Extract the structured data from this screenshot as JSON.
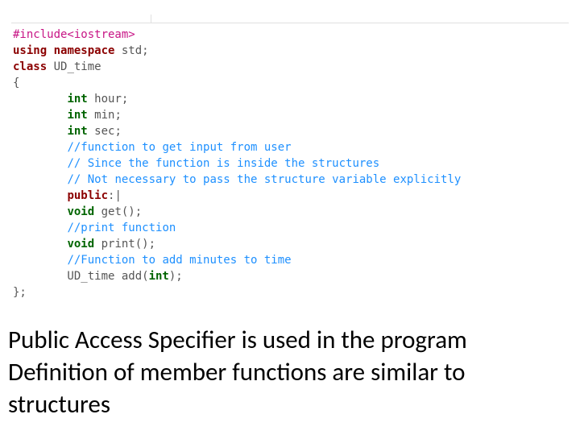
{
  "code": {
    "l01": {
      "a": "#include<iostream>"
    },
    "l02": {
      "a": "using",
      "b": " ",
      "c": "namespace",
      "d": " std;"
    },
    "l03": {
      "a": "class",
      "b": " UD_time"
    },
    "l04": {
      "a": "{"
    },
    "l05": {
      "a": "        ",
      "b": "int",
      "c": " hour;"
    },
    "l06": {
      "a": "        ",
      "b": "int",
      "c": " min;"
    },
    "l07": {
      "a": "        ",
      "b": "int",
      "c": " sec;"
    },
    "l08": {
      "a": "        ",
      "b": "//function to get input from user"
    },
    "l09": {
      "a": "        ",
      "b": "// Since the function is inside the structures"
    },
    "l10": {
      "a": "        ",
      "b": "// Not necessary to pass the structure variable explicitly"
    },
    "l11": {
      "a": "        ",
      "b": "public",
      "c": ":|"
    },
    "l12": {
      "a": "        ",
      "b": "void",
      "c": " get();"
    },
    "l13": {
      "a": "        ",
      "b": "//print function"
    },
    "l14": {
      "a": "        ",
      "b": "void",
      "c": " print();"
    },
    "l15": {
      "a": "        ",
      "b": "//Function to add minutes to time"
    },
    "l16": {
      "a": "        UD_time add(",
      "b": "int",
      "c": ");"
    },
    "l17": {
      "a": "};"
    }
  },
  "caption": {
    "line1": "Public Access Specifier is used in the program",
    "line2": "Definition of member functions are similar to",
    "line3": "structures"
  }
}
